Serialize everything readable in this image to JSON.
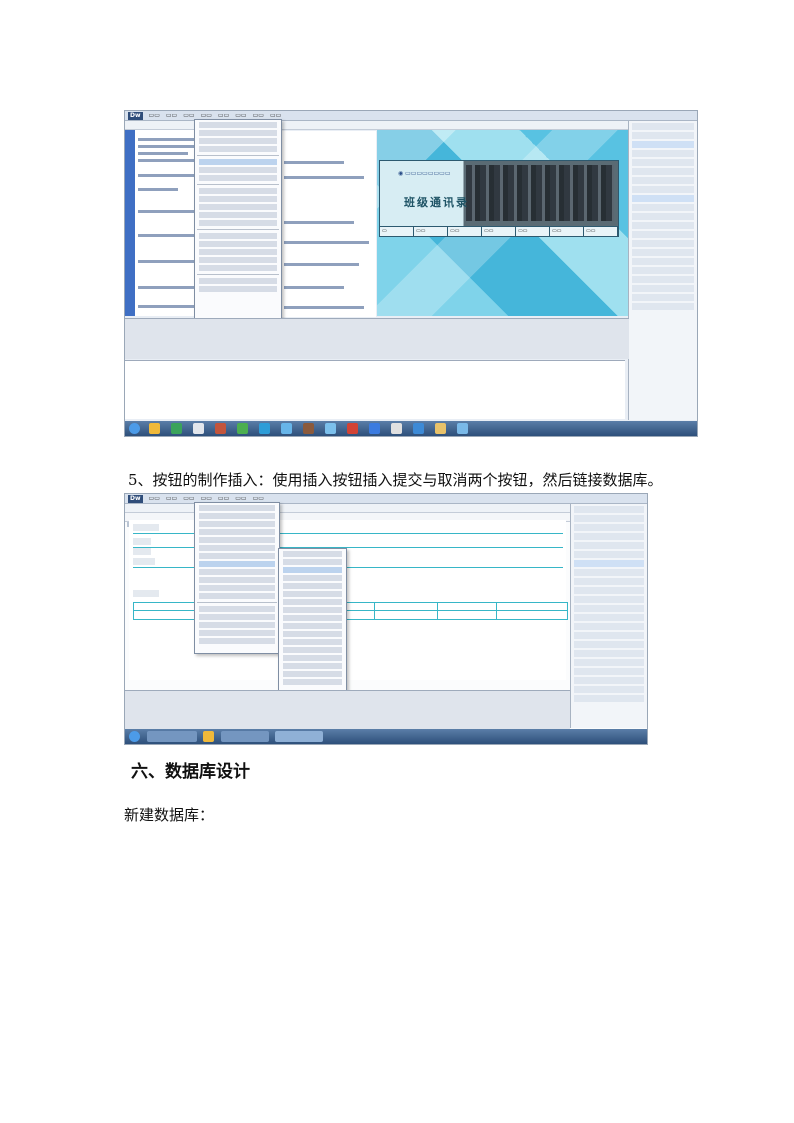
{
  "screenshot1": {
    "app_logo": "Dw",
    "banner_title": "班级通讯录",
    "icon": "dreamweaver-editor-screenshot"
  },
  "caption": "5、按钮的制作插入：使用插入按钮插入提交与取消两个按钮，然后链接数据库。",
  "screenshot2": {
    "app_logo": "Dw",
    "icon": "dreamweaver-insert-menu-screenshot"
  },
  "section_heading": "六、数据库设计",
  "section_text": "新建数据库："
}
